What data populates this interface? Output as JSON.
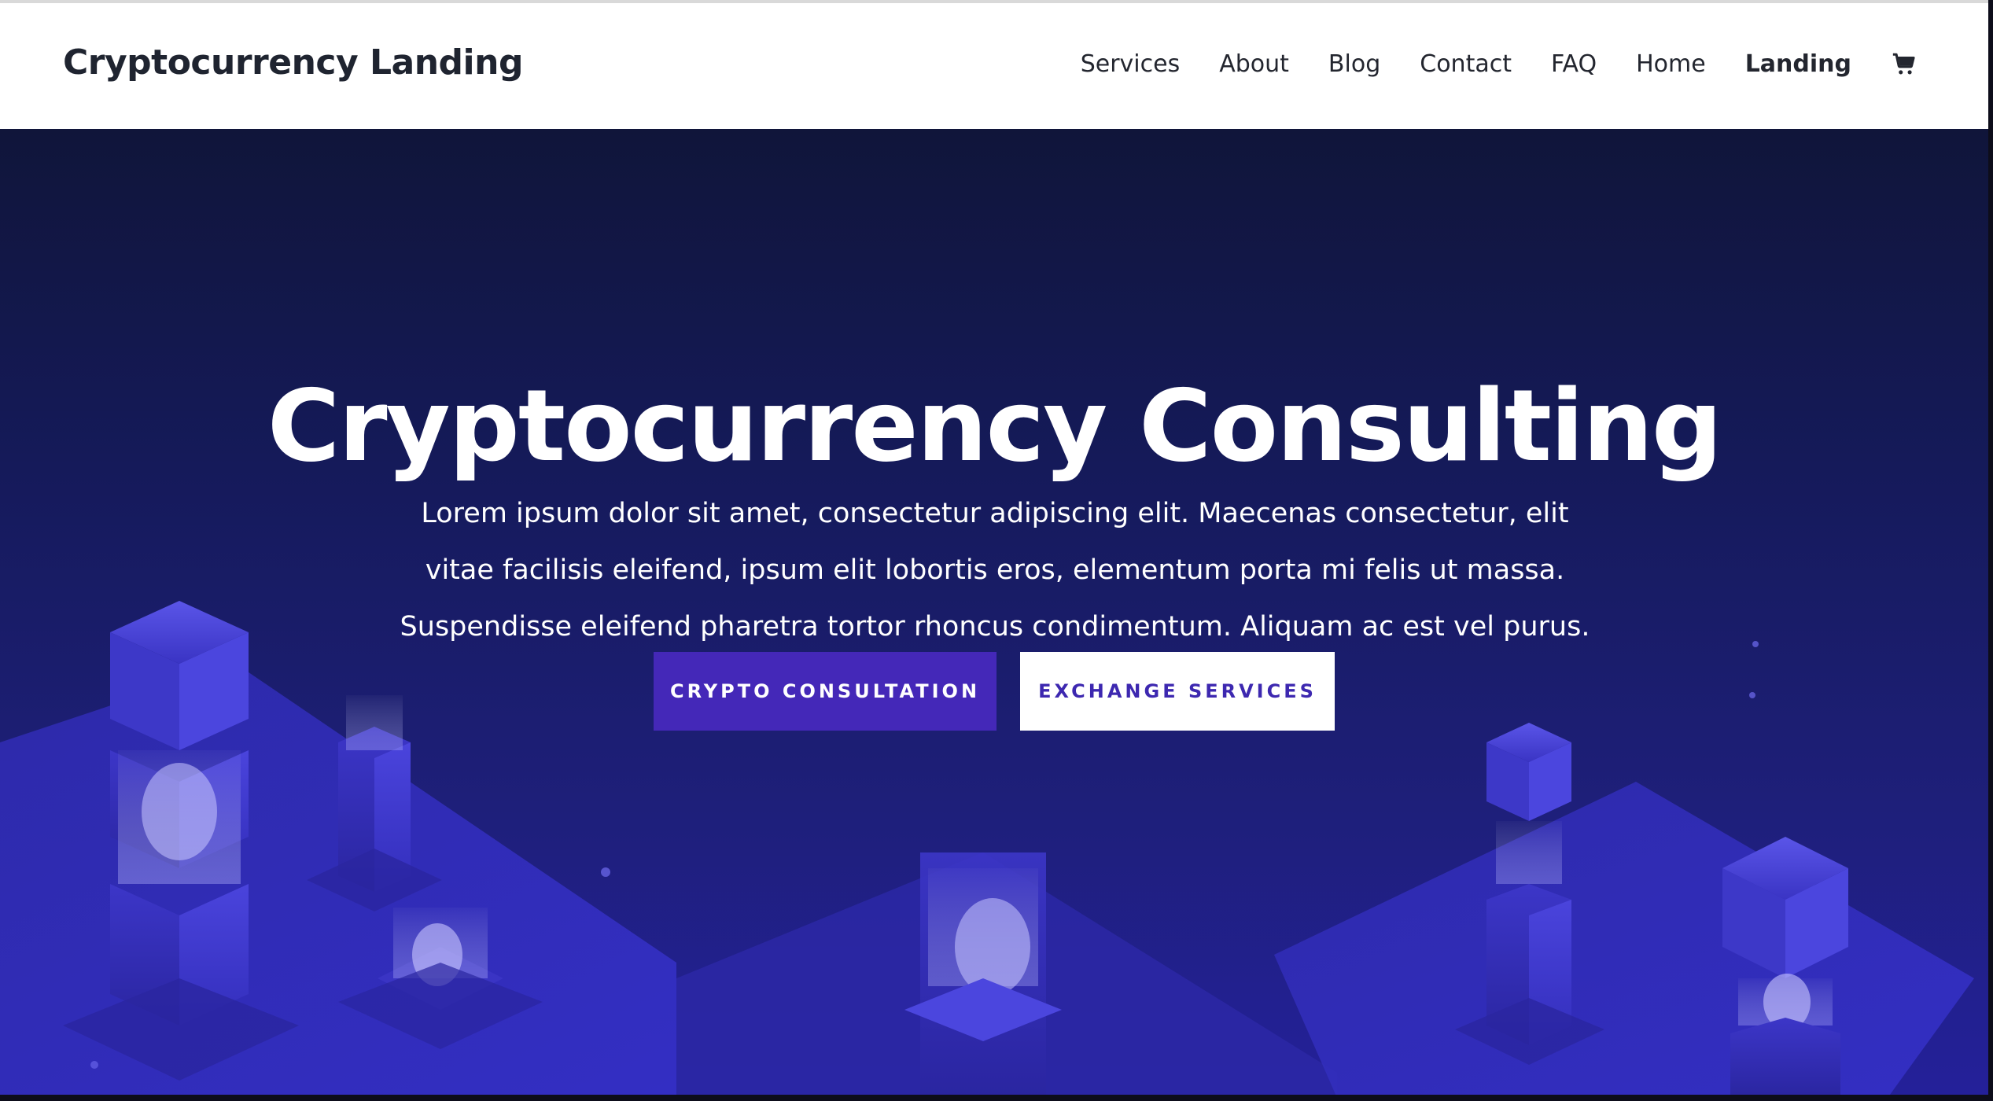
{
  "header": {
    "logo": "Cryptocurrency Landing",
    "nav": [
      "Services",
      "About",
      "Blog",
      "Contact",
      "FAQ",
      "Home",
      "Landing"
    ],
    "active_nav": "Landing",
    "cart_icon": "cart-icon"
  },
  "hero": {
    "title": "Cryptocurrency Consulting",
    "text": "Lorem ipsum dolor sit amet, consectetur adipiscing elit. Maecenas consectetur, elit vitae facilisis eleifend, ipsum elit lobortis eros, elementum porta mi felis ut massa. Suspendisse eleifend pharetra tortor rhoncus condimentum. Aliquam ac est vel purus.",
    "primary_button": "CRYPTO CONSULTATION",
    "secondary_button": "EXCHANGE SERVICES"
  },
  "colors": {
    "primary": "#4428b8",
    "hero_dark": "#10153a",
    "hero_light": "#24209a",
    "text_dark": "#1f2430"
  }
}
